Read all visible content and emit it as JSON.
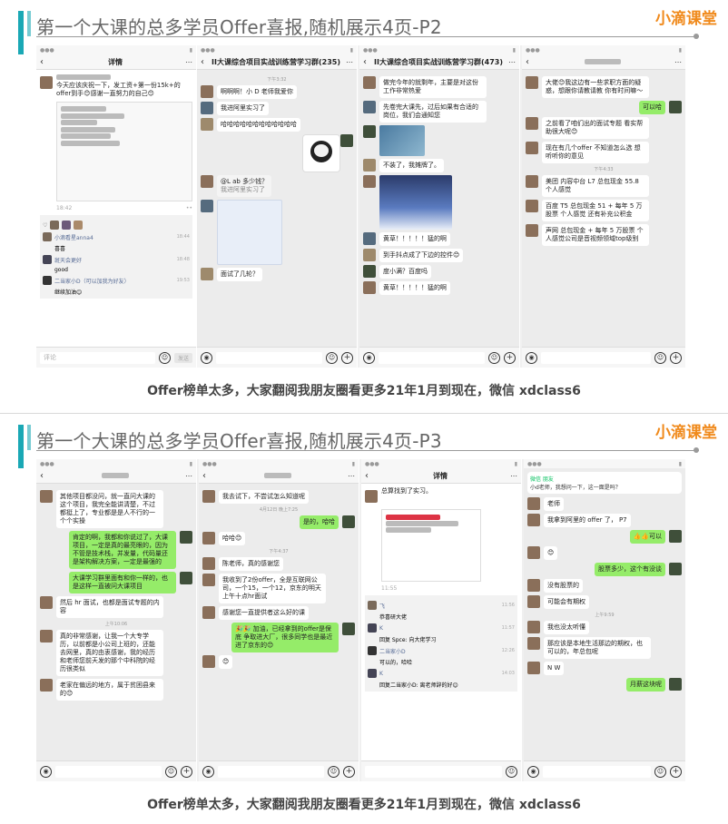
{
  "brand": "小滴课堂",
  "footer_text": "Offer榜单太多，大家翻阅我朋友圈看更多21年1月到现在，微信 xdclass6",
  "slides": [
    {
      "title": "第一个大课的总多学员Offer喜报,随机展示4页-P2",
      "phones": [
        {
          "nav_title": "详情",
          "post_text": "今天应该庆祝一下，发工资+第一份15k+的offer到手😊感谢一直努力的自己😊",
          "post_time": "18:42",
          "comments": [
            {
              "name": "小滴看星anna4",
              "text": "喜喜",
              "time": "18:44"
            },
            {
              "name": "斑天会更好",
              "text": "good",
              "time": "18:48"
            },
            {
              "name": "二当家小D（可以加我为好友）",
              "text": "继续加油😊",
              "time": "19:53"
            }
          ],
          "input_placeholder": "评论",
          "send_label": "发送"
        },
        {
          "nav_title": "II大课综合项目实战训练营学习群(235)",
          "time_divider": "下午3:32",
          "messages": [
            {
              "side": "left",
              "text": "啊啊啊！小 D 老师我爱你"
            },
            {
              "side": "left",
              "text": "我进阿里实习了"
            },
            {
              "side": "left",
              "text": "哈哈哈哈哈哈哈哈哈哈哈哈"
            },
            {
              "side": "left",
              "text": "@L  ab  多少钱？"
            },
            {
              "side": "left",
              "text": "我进阿里实习了"
            },
            {
              "side": "left",
              "text": "面试了几轮？"
            }
          ]
        },
        {
          "nav_title": "II大课综合项目实战训练营学习群(473)",
          "messages": [
            {
              "side": "left",
              "text": "做完今年的就剩年，主要是对这份工作非常热爱"
            },
            {
              "side": "left",
              "text": "先卷完大课先，过后如果有合适的岗位，我们会通知您"
            },
            {
              "side": "left",
              "text": "不装了，我摊牌了。"
            },
            {
              "side": "left",
              "text": "黄草！！！！！猛的啊"
            },
            {
              "side": "left",
              "text": "到手抖点成了下边的控件😊"
            },
            {
              "side": "left",
              "text": "度小满？百度吗"
            },
            {
              "side": "left",
              "text": "黄草！！！！！猛的啊"
            }
          ]
        },
        {
          "messages": [
            {
              "side": "left",
              "text": "大佬😊我这边有一些求职方面的疑惑，想跟你请教请教 你有时间嘛～"
            },
            {
              "side": "right",
              "text": "可以哈"
            },
            {
              "side": "left",
              "text": "之前看了咱们出的面试专题 看实帮助很大呢😊"
            },
            {
              "side": "left",
              "text": "现在有几个offer 不知道怎么选 想听听你的意见"
            },
            {
              "side": "left",
              "text": "美团 内容中台 L7 总包现金 55.8 个人感觉"
            },
            {
              "side": "left",
              "text": "百度 T5 总包现金 51 + 每年 5 万股票 个人感觉 还有补充公积金"
            },
            {
              "side": "left",
              "text": "声网 总包现金 + 每年 5 万股票 个人感觉公司是音视频领域top级别"
            }
          ],
          "time_divider": "下午4:33"
        }
      ]
    },
    {
      "title": "第一个大课的总多学员Offer喜报,随机展示4页-P3",
      "phones": [
        {
          "messages": [
            {
              "side": "left",
              "text": "其他项目都没问，就一直问大课的这个项目，我完全能讲清楚，不过都挺上了，专业都是是人不行的一个个实操"
            },
            {
              "side": "right",
              "text": "肯定的啊，我都和你说过了，大课项目，一定是真的最亮眼的，因为不管是技术栈，并发量，代码量还是架构解决方案，一定是最强的"
            },
            {
              "side": "right",
              "text": "大课学习群里面有和你一样的，也是这样一直被问大课项目"
            },
            {
              "side": "left",
              "text": "然后 hr 面试，也都是面试专题的内容"
            },
            {
              "side": "left",
              "text": "真的非常感谢，让我一个大专学历，以前都是小公司上班的，还能去网里，真的由衷感谢，我的经历和老师您前天发的那个中科院的经历很类似"
            },
            {
              "side": "left",
              "text": "老家在偏远的地方，属于贫困县来的😊"
            }
          ],
          "time_divider": "上午10:06"
        },
        {
          "messages": [
            {
              "side": "left",
              "text": "我去试下，不尝试怎么知道呢"
            },
            {
              "side": "right",
              "text": "是的，哈哈"
            },
            {
              "side": "left",
              "text": "哈哈😊"
            },
            {
              "side": "left",
              "text": "陈老师，真的感谢您"
            },
            {
              "side": "left",
              "text": "我收到了2份offer，全是互联网公司，一个15，一个12，京东的明天上午十点hr面试"
            },
            {
              "side": "left",
              "text": "感谢您一直提供者这么好的课"
            },
            {
              "side": "right",
              "text": "🎉🎉 加油，已经拿到的offer是保底 争取进大厂，很多同学也是最近进了京东的😊"
            },
            {
              "side": "left",
              "text": "😊"
            }
          ],
          "time_divider": "4月12日 晚上7:25",
          "time_divider2": "下午4:37"
        },
        {
          "nav_title": "详情",
          "post_text": "总算找到了实习。",
          "post_time": "11:55",
          "comments": [
            {
              "name": "飞",
              "text": "恭喜研大佬",
              "time": "11:56"
            },
            {
              "name": "K",
              "text": "回复 Spce: 向大佬学习",
              "time": "11:57"
            },
            {
              "name": "二当家小D",
              "text": "可以的，哈哈",
              "time": "12:26"
            },
            {
              "name": "K",
              "text": "回复二当家小D: 离老师辞的好😊",
              "time": "14:03"
            }
          ]
        },
        {
          "notice_title": "微信 朋友",
          "notice_text": "小d老师，我想问一下，这一面是吗？",
          "messages": [
            {
              "side": "left",
              "text": "老师"
            },
            {
              "side": "left",
              "text": "我拿到阿里的 offer 了， P7"
            },
            {
              "side": "right",
              "text": "👍👍可以"
            },
            {
              "side": "left",
              "text": "😊"
            },
            {
              "side": "right",
              "text": "股票多少，这个有没谈"
            },
            {
              "side": "left",
              "text": "没有股票的"
            },
            {
              "side": "left",
              "text": "可能会有期权"
            },
            {
              "side": "left",
              "text": "我也没太听懂"
            },
            {
              "side": "left",
              "text": "那应该是本地生活那边的期权，也可以的，年总包呢"
            },
            {
              "side": "left",
              "text": "N  W"
            },
            {
              "side": "right",
              "text": "月薪这块呢"
            }
          ],
          "time_divider": "上午9:59"
        }
      ]
    }
  ]
}
